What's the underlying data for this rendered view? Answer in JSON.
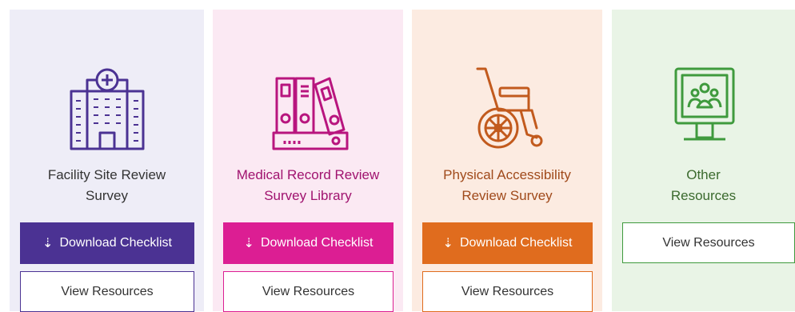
{
  "cards": [
    {
      "title_line1": "Facility Site Review",
      "title_line2": "Survey",
      "download_label": "Download Checklist",
      "resources_label": "View Resources",
      "icon": "hospital-building-icon",
      "accent": "#4b3293"
    },
    {
      "title_line1": "Medical Record Review",
      "title_line2": "Survey Library",
      "download_label": "Download Checklist",
      "resources_label": "View Resources",
      "icon": "binders-library-icon",
      "accent": "#dc1e93"
    },
    {
      "title_line1": "Physical Accessibility",
      "title_line2": "Review Survey",
      "download_label": "Download Checklist",
      "resources_label": "View Resources",
      "icon": "wheelchair-icon",
      "accent": "#e06c1e"
    },
    {
      "title_line1": "Other",
      "title_line2": "Resources",
      "resources_label": "View Resources",
      "icon": "computer-monitor-people-icon",
      "accent": "#3f9a3d"
    }
  ]
}
